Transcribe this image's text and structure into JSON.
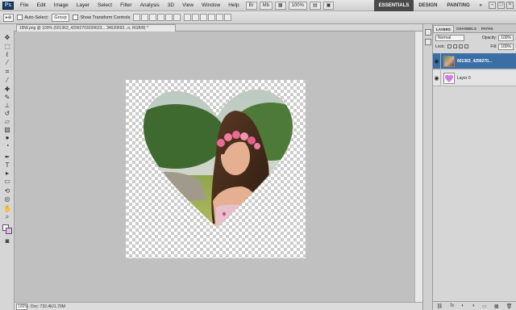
{
  "menubar": {
    "logo": "Ps",
    "items": [
      "File",
      "Edit",
      "Image",
      "Layer",
      "Select",
      "Filter",
      "Analysis",
      "3D",
      "View",
      "Window",
      "Help"
    ],
    "zoom": "100%",
    "workspaces": [
      "ESSENTIALS",
      "DESIGN",
      "PAINTING",
      "»"
    ],
    "window_controls": [
      "–",
      "□",
      "×"
    ]
  },
  "options": {
    "auto_select_label": "Auto-Select:",
    "auto_select_value": "Group",
    "transform_label": "Show Transform Controls"
  },
  "document": {
    "tab_title": "1BW.png @ 100% (601363_42992703039623... 34630693...n, RGB/8) *",
    "status_zoom": "100%",
    "status_doc": "Doc: 732.4K/1.70M"
  },
  "panels": {
    "tabs": [
      "LAYERS",
      "CHANNELS",
      "PATHS"
    ],
    "blend_mode": "Normal",
    "opacity_label": "Opacity:",
    "opacity": "100%",
    "lock_label": "Lock:",
    "fill_label": "Fill:",
    "fill": "100%",
    "layers": [
      {
        "name": "601363_4299270...",
        "selected": true
      },
      {
        "name": "Layer 0",
        "selected": false
      }
    ],
    "bottom_icons": [
      "⛓",
      "fx",
      "◐",
      "◑",
      "▭",
      "▦",
      "🗑"
    ]
  },
  "colors": {
    "selection": "#3a6ea5",
    "canvas_bg": "#c0c0c0",
    "heart_layer": "#d17de0"
  }
}
